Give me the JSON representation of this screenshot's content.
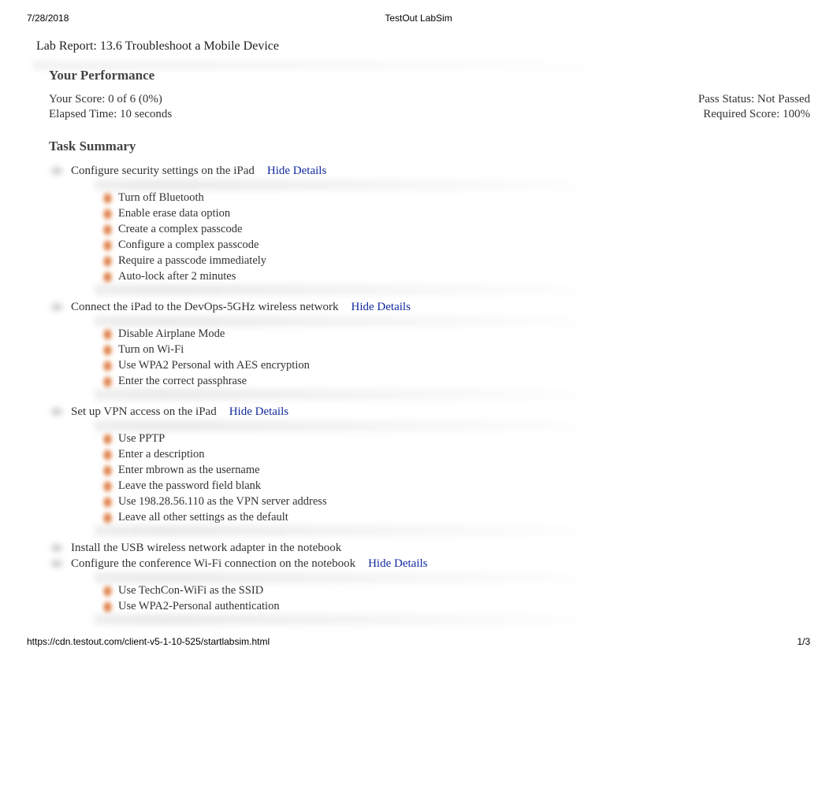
{
  "header": {
    "date": "7/28/2018",
    "app_title": "TestOut LabSim"
  },
  "report": {
    "title": "Lab Report: 13.6 Troubleshoot a Mobile Device"
  },
  "performance": {
    "heading": "Your Performance",
    "score_label": "Your Score: 0 of 6 (0%)",
    "pass_status": "Pass Status: Not Passed",
    "elapsed": "Elapsed Time: 10 seconds",
    "required": "Required Score: 100%"
  },
  "task_summary_heading": "Task Summary",
  "hide_details_label": "Hide Details",
  "tasks": [
    {
      "title": "Configure security settings on the iPad",
      "has_details": true,
      "details": [
        "Turn off Bluetooth",
        "Enable erase data option",
        "Create a complex passcode",
        "Configure a complex passcode",
        "Require a passcode immediately",
        "Auto-lock after 2 minutes"
      ]
    },
    {
      "title": "Connect the iPad to the DevOps-5GHz wireless network",
      "has_details": true,
      "details": [
        "Disable Airplane Mode",
        "Turn on Wi-Fi",
        "Use WPA2 Personal with AES encryption",
        "Enter the correct passphrase"
      ]
    },
    {
      "title": "Set up VPN access on the iPad",
      "has_details": true,
      "details": [
        "Use PPTP",
        "Enter a description",
        "Enter mbrown as the username",
        "Leave the password field blank",
        "Use 198.28.56.110 as the VPN server address",
        "Leave all other settings as the default"
      ]
    },
    {
      "title": "Install the USB wireless network adapter in the notebook",
      "has_details": false,
      "details": []
    },
    {
      "title": "Configure the conference Wi-Fi connection on the notebook",
      "has_details": true,
      "details": [
        "Use TechCon-WiFi as the SSID",
        "Use WPA2-Personal authentication"
      ]
    }
  ],
  "footer": {
    "url": "https://cdn.testout.com/client-v5-1-10-525/startlabsim.html",
    "page_num": "1/3"
  }
}
